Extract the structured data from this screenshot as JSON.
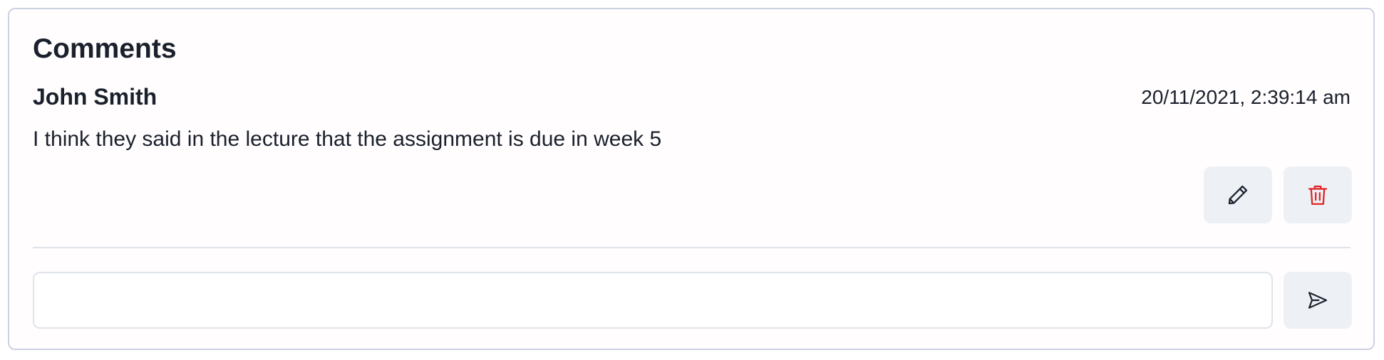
{
  "comments_panel": {
    "title": "Comments",
    "comment": {
      "author": "John Smith",
      "timestamp": "20/11/2021, 2:39:14 am",
      "text": "I think they said in the lecture that the assignment is due in week 5",
      "actions": {
        "edit_icon": "pencil-icon",
        "delete_icon": "trash-icon",
        "delete_color": "#e02424"
      }
    },
    "new_comment": {
      "value": "",
      "placeholder": "",
      "send_icon": "send-icon"
    }
  }
}
